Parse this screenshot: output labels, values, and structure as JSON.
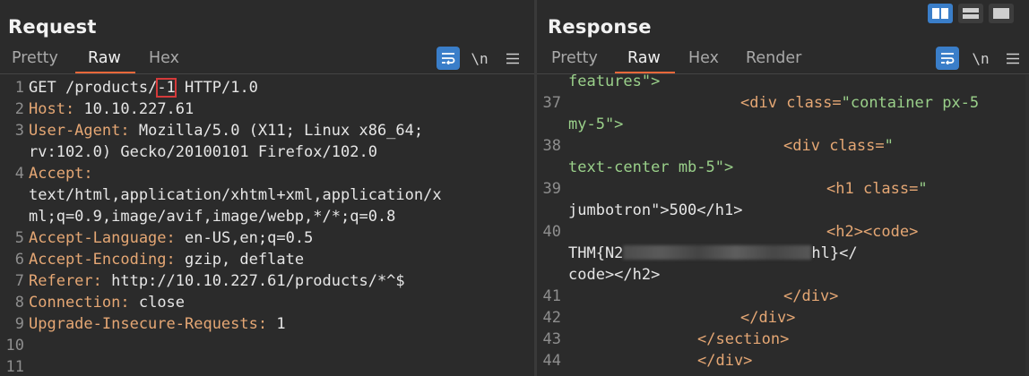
{
  "request": {
    "title": "Request",
    "tabs": [
      {
        "label": "Pretty",
        "active": false
      },
      {
        "label": "Raw",
        "active": true
      },
      {
        "label": "Hex",
        "active": false
      }
    ],
    "newline_label": "\\n",
    "lines": [
      {
        "num": "1",
        "method": "GET",
        "path_before": " /products/",
        "marked": "-1",
        "path_after": " HTTP/1.0"
      },
      {
        "num": "2",
        "key": "Host",
        "value": " 10.10.227.61"
      },
      {
        "num": "3",
        "key": "User-Agent",
        "value": " Mozilla/5.0 (X11; Linux x86_64;",
        "cont": [
          "rv:102.0) Gecko/20100101 Firefox/102.0"
        ]
      },
      {
        "num": "4",
        "key": "Accept",
        "value": "",
        "cont": [
          "text/html,application/xhtml+xml,application/x",
          "ml;q=0.9,image/avif,image/webp,*/*;q=0.8"
        ]
      },
      {
        "num": "5",
        "key": "Accept-Language",
        "value": " en-US,en;q=0.5"
      },
      {
        "num": "6",
        "key": "Accept-Encoding",
        "value": " gzip, deflate"
      },
      {
        "num": "7",
        "key": "Referer",
        "value": " http://10.10.227.61/products/*^$"
      },
      {
        "num": "8",
        "key": "Connection",
        "value": " close"
      },
      {
        "num": "9",
        "key": "Upgrade-Insecure-Requests",
        "value": " 1"
      },
      {
        "num": "10"
      },
      {
        "num": "11"
      }
    ]
  },
  "response": {
    "title": "Response",
    "tabs": [
      {
        "label": "Pretty",
        "active": false
      },
      {
        "label": "Raw",
        "active": true
      },
      {
        "label": "Hex",
        "active": false
      },
      {
        "label": "Render",
        "active": false
      }
    ],
    "newline_label": "\\n",
    "partial_line": "features\">",
    "lines": [
      {
        "num": "37",
        "a": "<div",
        "b": " class=",
        "c": "\"container px-5",
        "cont": "my-5\">"
      },
      {
        "num": "38",
        "a": "<div",
        "b": " class=",
        "c": "\"",
        "cont": "text-center mb-5\">"
      },
      {
        "num": "39",
        "a": "<h1",
        "b": " class=",
        "c": "\"",
        "cont": "jumbotron\">500</h1>"
      },
      {
        "num": "40",
        "a": "<h2><code>",
        "cont_prefix": "THM{N2",
        "cont_suffix": "hl}</",
        "cont2": "code></h2>"
      },
      {
        "num": "41",
        "a": "</div>"
      },
      {
        "num": "42",
        "a": "</div>"
      },
      {
        "num": "43",
        "a": "</section>"
      },
      {
        "num": "44",
        "a": "</div>"
      }
    ]
  },
  "colors": {
    "accent": "#3a7ec9",
    "tab_underline": "#e8683a",
    "header_key": "#e5a774",
    "highlight_box": "#d53a3a"
  },
  "icons": [
    "wrap-lines-icon",
    "newline-icon",
    "menu-icon",
    "side-by-side-layout-icon",
    "horizontal-layout-icon",
    "single-pane-layout-icon"
  ]
}
